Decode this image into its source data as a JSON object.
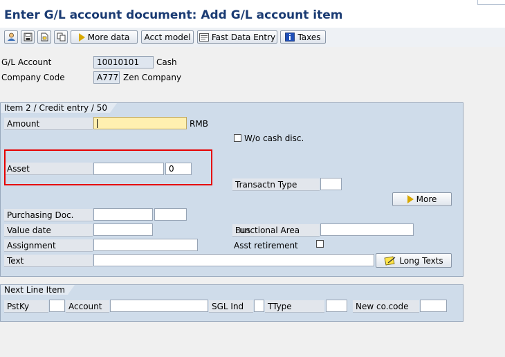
{
  "header": {
    "title": "Enter G/L account document: Add G/L account item"
  },
  "toolbar": {
    "icons": [
      "person-icon",
      "save-icon",
      "document-icon",
      "copy-icon",
      "info-icon"
    ],
    "more_data_label": "More data",
    "acct_model_label": "Acct model",
    "fast_data_entry_label": "Fast Data Entry",
    "taxes_label": "Taxes"
  },
  "header_fields": {
    "gl_account_label": "G/L Account",
    "gl_account_value": "10010101",
    "gl_account_desc": "Cash",
    "company_code_label": "Company Code",
    "company_code_value": "A777",
    "company_name": "Zen Company"
  },
  "item_group": {
    "title": "Item 2 / Credit entry / 50",
    "amount_label": "Amount",
    "amount_value": "",
    "currency": "RMB",
    "wo_cash_disc_label": "W/o cash disc.",
    "asset_label": "Asset",
    "asset_value": "",
    "asset_sub_value": "0",
    "transactn_type_label": "Transactn Type",
    "more_button_label": "More",
    "purchasing_doc_label": "Purchasing Doc.",
    "value_date_label": "Value date",
    "functional_area_label": "Functional Area",
    "functional_area_overlap": "Bus",
    "assignment_label": "Assignment",
    "asst_retirement_label": "Asst retirement",
    "text_label": "Text",
    "long_texts_label": "Long Texts"
  },
  "next_line_group": {
    "title": "Next Line Item",
    "pstky_label": "PstKy",
    "account_label": "Account",
    "sgl_ind_label": "SGL Ind",
    "ttype_label": "TType",
    "new_co_code_label": "New co.code"
  },
  "colors": {
    "highlight": "#e60000",
    "title": "#1a3b73",
    "required_field": "#fff0b0"
  }
}
